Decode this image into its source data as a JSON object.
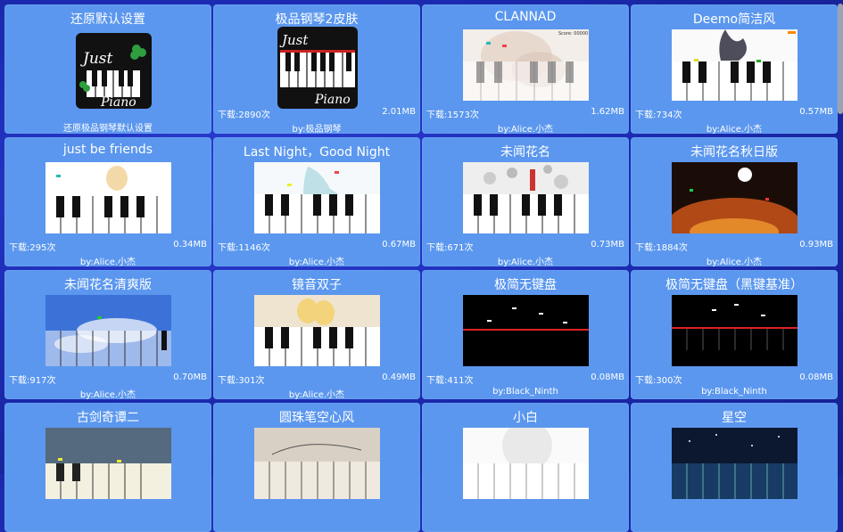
{
  "skins": [
    {
      "title": "还原默认设置",
      "author": "还原极品钢琴默认设置",
      "downloads": "",
      "size": ""
    },
    {
      "title": "极品钢琴2皮肤",
      "author": "by:极品钢琴",
      "downloads": "下载:2890次",
      "size": "2.01MB"
    },
    {
      "title": "CLANNAD",
      "author": "by:Alice.小杰",
      "downloads": "下载:1573次",
      "size": "1.62MB"
    },
    {
      "title": "Deemo简洁风",
      "author": "by:Alice.小杰",
      "downloads": "下载:734次",
      "size": "0.57MB"
    },
    {
      "title": "just be friends",
      "author": "by:Alice.小杰",
      "downloads": "下载:295次",
      "size": "0.34MB"
    },
    {
      "title": "Last Night，Good Night",
      "author": "by:Alice.小杰",
      "downloads": "下载:1146次",
      "size": "0.67MB"
    },
    {
      "title": "未闻花名",
      "author": "by:Alice.小杰",
      "downloads": "下载:671次",
      "size": "0.73MB"
    },
    {
      "title": "未闻花名秋日版",
      "author": "by:Alice.小杰",
      "downloads": "下载:1884次",
      "size": "0.93MB"
    },
    {
      "title": "未闻花名清爽版",
      "author": "by:Alice.小杰",
      "downloads": "下载:917次",
      "size": "0.70MB"
    },
    {
      "title": "镜音双子",
      "author": "by:Alice.小杰",
      "downloads": "下载:301次",
      "size": "0.49MB"
    },
    {
      "title": "极简无键盘",
      "author": "by:Black_Ninth",
      "downloads": "下载:411次",
      "size": "0.08MB"
    },
    {
      "title": "极简无键盘（黑键基准）",
      "author": "by:Black_Ninth",
      "downloads": "下载:300次",
      "size": "0.08MB"
    },
    {
      "title": "古剑奇谭二",
      "author": "",
      "downloads": "",
      "size": ""
    },
    {
      "title": "圆珠笔空心风",
      "author": "",
      "downloads": "",
      "size": ""
    },
    {
      "title": "小白",
      "author": "",
      "downloads": "",
      "size": ""
    },
    {
      "title": "星空",
      "author": "",
      "downloads": "",
      "size": ""
    }
  ],
  "logo": {
    "just": "Just",
    "piano": "Piano"
  },
  "thumb_text": {
    "score": "Score: 00000"
  },
  "colors": {
    "card": "#5b97ee",
    "background": "#1d2bb4",
    "text": "#ffffff"
  }
}
